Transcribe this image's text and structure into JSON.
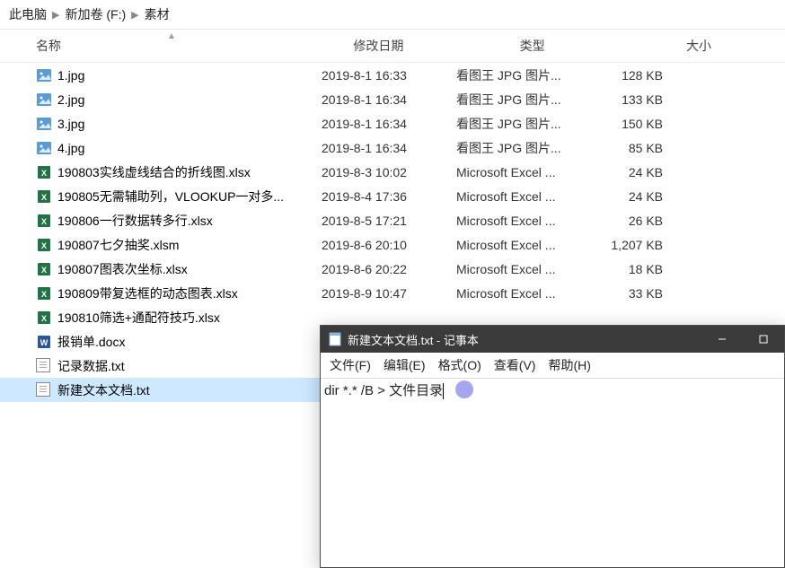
{
  "breadcrumb": [
    "此电脑",
    "新加卷 (F:)",
    "素材"
  ],
  "columns": {
    "name": "名称",
    "date": "修改日期",
    "type": "类型",
    "size": "大小"
  },
  "files": [
    {
      "name": "1.jpg",
      "date": "2019-8-1 16:33",
      "type": "看图王 JPG 图片...",
      "size": "128 KB",
      "icon": "jpg"
    },
    {
      "name": "2.jpg",
      "date": "2019-8-1 16:34",
      "type": "看图王 JPG 图片...",
      "size": "133 KB",
      "icon": "jpg"
    },
    {
      "name": "3.jpg",
      "date": "2019-8-1 16:34",
      "type": "看图王 JPG 图片...",
      "size": "150 KB",
      "icon": "jpg"
    },
    {
      "name": "4.jpg",
      "date": "2019-8-1 16:34",
      "type": "看图王 JPG 图片...",
      "size": "85 KB",
      "icon": "jpg"
    },
    {
      "name": "190803实线虚线结合的折线图.xlsx",
      "date": "2019-8-3 10:02",
      "type": "Microsoft Excel ...",
      "size": "24 KB",
      "icon": "xls"
    },
    {
      "name": "190805无需辅助列，VLOOKUP一对多...",
      "date": "2019-8-4 17:36",
      "type": "Microsoft Excel ...",
      "size": "24 KB",
      "icon": "xls"
    },
    {
      "name": "190806一行数据转多行.xlsx",
      "date": "2019-8-5 17:21",
      "type": "Microsoft Excel ...",
      "size": "26 KB",
      "icon": "xls"
    },
    {
      "name": "190807七夕抽奖.xlsm",
      "date": "2019-8-6 20:10",
      "type": "Microsoft Excel ...",
      "size": "1,207 KB",
      "icon": "xls"
    },
    {
      "name": "190807图表次坐标.xlsx",
      "date": "2019-8-6 20:22",
      "type": "Microsoft Excel ...",
      "size": "18 KB",
      "icon": "xls"
    },
    {
      "name": "190809带复选框的动态图表.xlsx",
      "date": "2019-8-9 10:47",
      "type": "Microsoft Excel ...",
      "size": "33 KB",
      "icon": "xls"
    },
    {
      "name": "190810筛选+通配符技巧.xlsx",
      "date": "",
      "type": "",
      "size": "",
      "icon": "xls"
    },
    {
      "name": "报销单.docx",
      "date": "",
      "type": "",
      "size": "",
      "icon": "doc"
    },
    {
      "name": "记录数据.txt",
      "date": "",
      "type": "",
      "size": "",
      "icon": "txt"
    },
    {
      "name": "新建文本文档.txt",
      "date": "",
      "type": "",
      "size": "",
      "icon": "txt",
      "selected": true
    }
  ],
  "notepad": {
    "title": "新建文本文档.txt - 记事本",
    "menu": [
      "文件(F)",
      "编辑(E)",
      "格式(O)",
      "查看(V)",
      "帮助(H)"
    ],
    "content": "dir *.* /B > 文件目录"
  }
}
